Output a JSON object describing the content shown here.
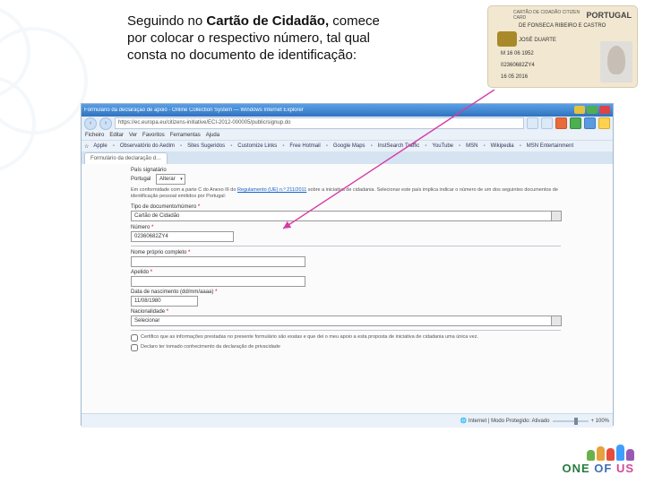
{
  "instruction": {
    "line1_pre": "Seguindo no ",
    "line1_bold": "Cartão de Cidadão,",
    "rest": " comece por colocar o respectivo número, tal qual consta no documento de identificação:"
  },
  "card": {
    "header": "CARTÃO DE CIDADÃO  CITIZEN CARD",
    "flag": "PORTUGAL",
    "surname": "DE FONSECA RIBEIRO E CASTRO",
    "given": "JOSÉ DUARTE",
    "sex_birth": "M   16  06 1952",
    "doc_no": "02360682ZY4",
    "expiry": "16 05 2016"
  },
  "browser": {
    "title": "Formulário da declaração de apoio - Online Collection System — Windows Internet Explorer",
    "url": "https://ec.europa.eu/citizens-initiative/ECI-2012-000005/public/signup.do",
    "menu": [
      "Ficheiro",
      "Editar",
      "Ver",
      "Favoritos",
      "Ferramentas",
      "Ajuda"
    ],
    "fav": [
      "Apple",
      "Observatório do Aedim",
      "Sites Sugeridos",
      "Customize Links",
      "Free Hotmail",
      "Google Maps",
      "InstSearch Traffic",
      "YouTube",
      "MSN",
      "Wikipedia",
      "MSN Entertainment"
    ],
    "tab": "Formulário da declaração d…",
    "status": "Internet | Modo Protegido: Ativado",
    "zoom": "+ 100%"
  },
  "form": {
    "pais_label": "País signatário",
    "pais_value": "Portugal",
    "pais_btn": "Alterar",
    "info_a": "Em conformidade com a parte C do Anexo III do ",
    "info_link": "Regulamento (UE) n.º 211/2011",
    "info_b": " sobre a iniciativa de cidadania. Selecionar este país implica indicar o número de um dos seguintes documentos de identificação pessoal emitidos por Portugal:",
    "tipo_label": "Tipo de documento/número",
    "tipo_value": "Cartão de Cidadão",
    "numero_label": "Número",
    "numero_value": "02360682ZY4",
    "nome_label": "Nome próprio completo",
    "apelido_label": "Apelido",
    "data_label": "Data de nascimento (dd/mm/aaaa)",
    "data_value": "11/08/1980",
    "nac_label": "Nacionalidade",
    "nac_value": "Selecionar",
    "req": "*",
    "chk1": "Certifico que as informações prestadas no presente formulário são exatas e que dei o meu apoio a esta proposta de iniciativa de cidadania uma única vez.",
    "chk2_a": "Declaro ter tomado conhecimento da ",
    "chk2_link": "declaração de privacidade"
  },
  "logo": {
    "one": "ONE",
    "of": " OF ",
    "us": "US"
  }
}
